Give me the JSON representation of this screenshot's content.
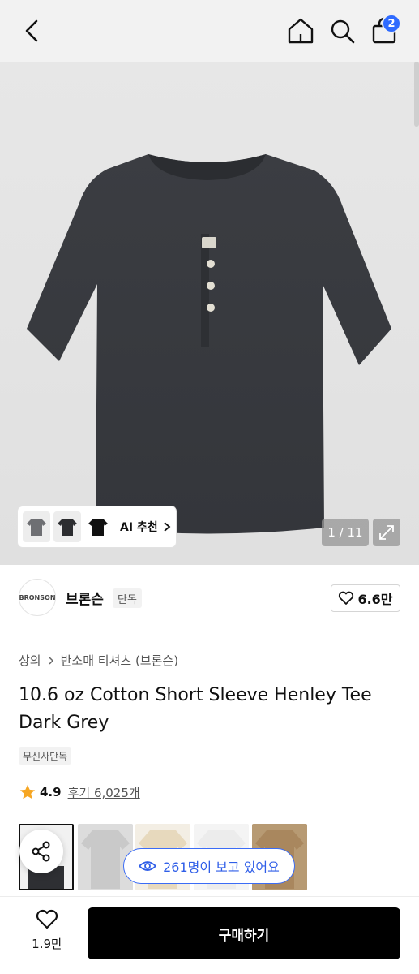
{
  "header": {
    "cart_count": "2"
  },
  "gallery": {
    "counter": "1 / 11",
    "ai_label": "AI 추천"
  },
  "brand": {
    "logo_text": "BRONSON",
    "name": "브론슨",
    "tag": "단독",
    "like_count": "6.6만"
  },
  "breadcrumb": {
    "category": "상의",
    "subcategory": "반소매 티셔츠 (브론슨)"
  },
  "product": {
    "title": "10.6 oz Cotton Short Sleeve Henley Tee Dark Grey",
    "exclusive_tag": "무신사단독",
    "rating": "4.9",
    "reviews": "후기 6,025개"
  },
  "viewers": {
    "text": "261명이 보고 있어요"
  },
  "bottom": {
    "like_count": "1.9만",
    "buy_label": "구매하기"
  },
  "colors": {
    "accent": "#2f6bff",
    "star": "#f6a623",
    "buy": "#000000"
  },
  "icons": [
    "back-icon",
    "home-icon",
    "search-icon",
    "bag-icon",
    "chevron-right-icon",
    "expand-icon",
    "heart-icon",
    "star-icon",
    "share-icon",
    "eye-icon"
  ]
}
